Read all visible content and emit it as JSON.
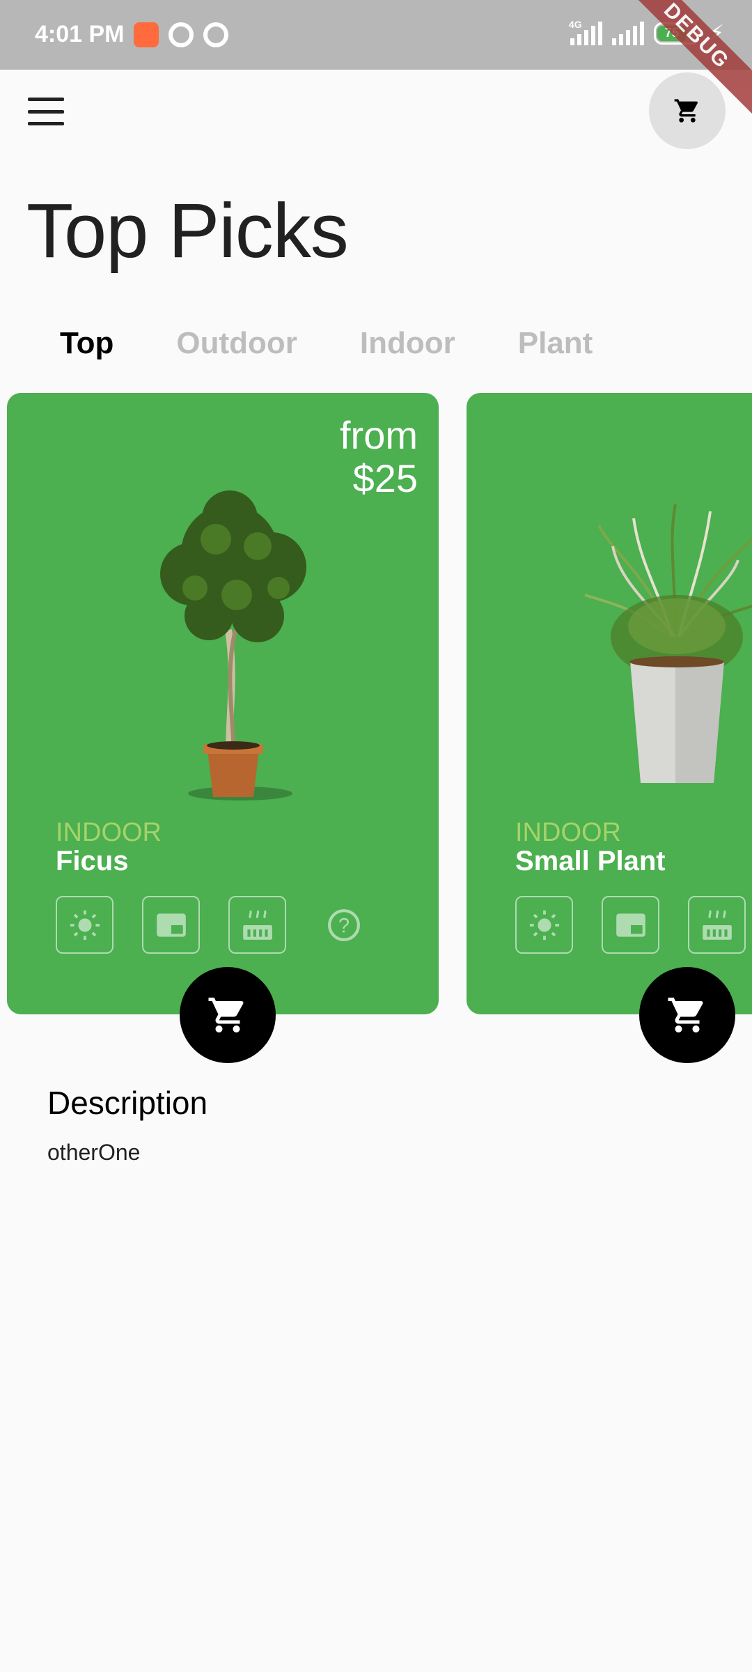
{
  "status_bar": {
    "time": "4:01 PM",
    "network_type": "4G",
    "battery_level": "75",
    "icons": [
      "app-notification-icon",
      "sync-icon",
      "sync-icon",
      "signal-icon",
      "signal-icon",
      "battery-icon",
      "charging-icon"
    ]
  },
  "debug_banner": "DEBUG",
  "app_bar": {
    "menu_icon": "hamburger-menu-icon",
    "cart_icon": "shopping-cart-icon"
  },
  "page_title": "Top Picks",
  "tabs": [
    {
      "label": "Top",
      "active": true
    },
    {
      "label": "Outdoor",
      "active": false
    },
    {
      "label": "Indoor",
      "active": false
    },
    {
      "label": "Plant",
      "active": false
    }
  ],
  "cards": [
    {
      "price_prefix": "from",
      "price": "$25",
      "category": "INDOOR",
      "name": "Ficus",
      "features": [
        "sun-icon",
        "window-icon",
        "humidity-icon",
        "help-icon"
      ]
    },
    {
      "category": "INDOOR",
      "name": "Small Plant",
      "features": [
        "sun-icon",
        "window-icon",
        "humidity-icon"
      ]
    }
  ],
  "description": {
    "title": "Description",
    "body": "otherOne"
  },
  "colors": {
    "card_green": "#4caf50",
    "category_green": "#a5d36a",
    "tab_inactive": "#bdbdbd",
    "background": "#fafafa"
  }
}
